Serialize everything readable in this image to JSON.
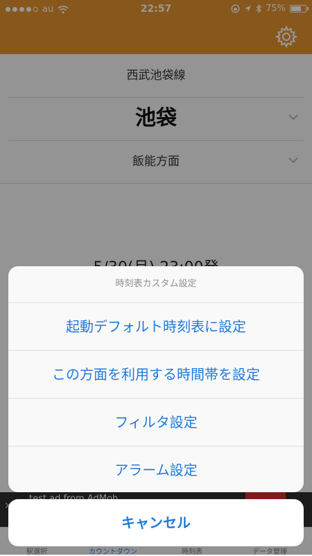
{
  "status_bar": {
    "carrier": "au",
    "time": "22:57",
    "battery": "75%",
    "battery_level": 0.75
  },
  "colors": {
    "accent": "#e3912d",
    "action_blue": "#1f7ad9"
  },
  "navbar": {
    "settings_icon": "gear-icon"
  },
  "route": {
    "line_name": "西武池袋線",
    "station": "池袋",
    "direction": "飯能方面"
  },
  "departure": {
    "text": "5/30(月) 23:00発"
  },
  "ad": {
    "text": "test ad from AdMob"
  },
  "tabbar": {
    "tabs": [
      "駅選択",
      "カウントダウン",
      "時刻表",
      "データ管理"
    ],
    "active_index": 1
  },
  "action_sheet": {
    "title": "時刻表カスタム設定",
    "items": [
      "起動デフォルト時刻表に設定",
      "この方面を利用する時間帯を設定",
      "フィルタ設定",
      "アラーム設定"
    ],
    "cancel_label": "キャンセル"
  }
}
